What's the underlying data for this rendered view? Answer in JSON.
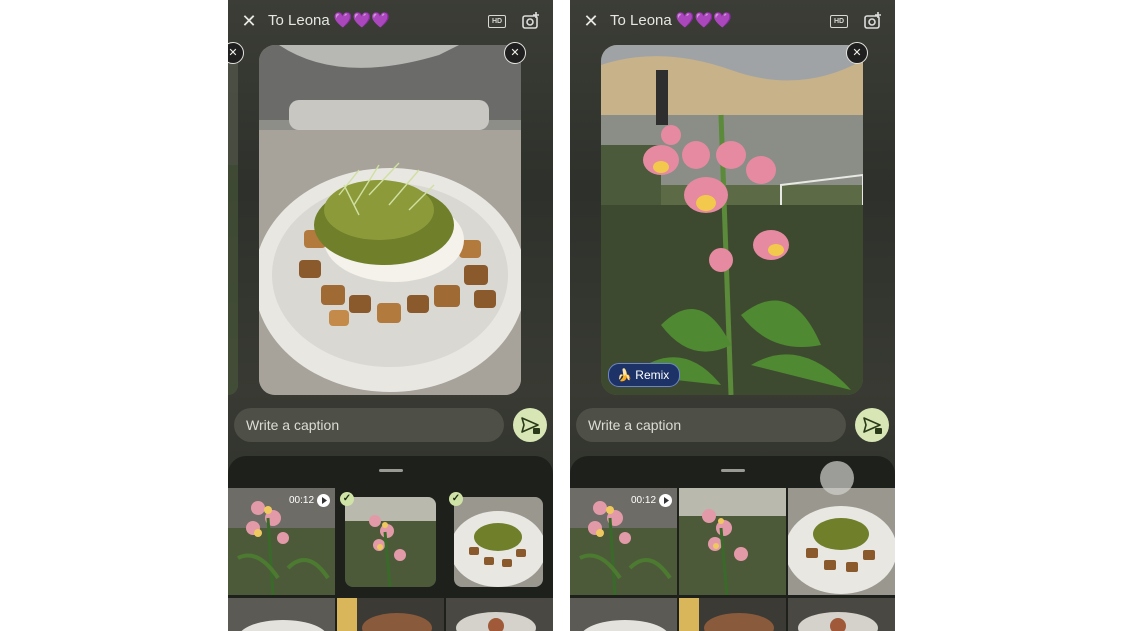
{
  "left_screen": {
    "title": "To Leona 💜💜💜",
    "hd_label": "HD",
    "caption_placeholder": "Write a caption",
    "video_duration": "00:12"
  },
  "right_screen": {
    "title": "To Leona 💜💜💜",
    "hd_label": "HD",
    "caption_placeholder": "Write a caption",
    "video_duration": "00:12",
    "remix_label": "Remix"
  },
  "colors": {
    "send_button": "#d8e6b5",
    "remix_chip": "#1d3367",
    "check_badge": "#cfe3a6"
  }
}
